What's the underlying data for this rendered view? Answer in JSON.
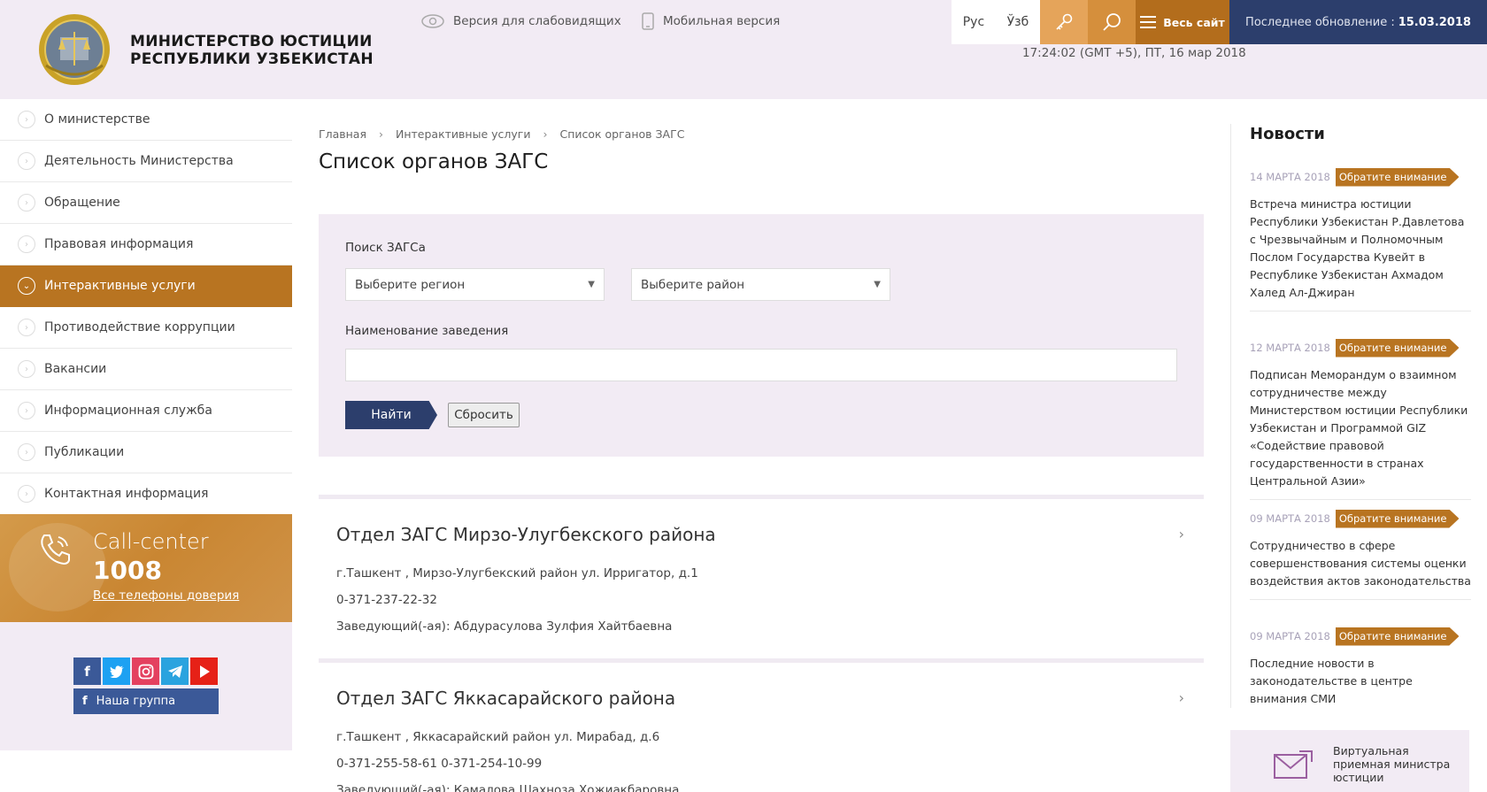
{
  "header": {
    "org_line1": "МИНИСТЕРСТВО ЮСТИЦИИ",
    "org_line2": "РЕСПУБЛИКИ УЗБЕКИСТАН",
    "accessibility_label": "Версия для слабовидящих",
    "mobile_label": "Мобильная версия",
    "lang_ru": "Рус",
    "lang_uz": "Ўзб",
    "menu_label": "Весь сайт",
    "update_label": "Последнее обновление :",
    "update_date": "15.03.2018",
    "datetime": "17:24:02 (GMT +5), ПТ, 16 мар 2018"
  },
  "sidebar": {
    "items": [
      {
        "label": "О министерстве",
        "active": false
      },
      {
        "label": "Деятельность Министерства",
        "active": false
      },
      {
        "label": "Обращение",
        "active": false
      },
      {
        "label": "Правовая информация",
        "active": false
      },
      {
        "label": "Интерактивные услуги",
        "active": true
      },
      {
        "label": "Противодействие коррупции",
        "active": false
      },
      {
        "label": "Вакансии",
        "active": false
      },
      {
        "label": "Информационная служба",
        "active": false
      },
      {
        "label": "Публикации",
        "active": false
      },
      {
        "label": "Контактная информация",
        "active": false
      }
    ],
    "callcenter": {
      "title": "Call-center",
      "number": "1008",
      "link": "Все телефоны доверия"
    },
    "social": {
      "facebook": "f",
      "group_label": "Наша группа"
    }
  },
  "breadcrumb": {
    "home": "Главная",
    "section": "Интерактивные услуги",
    "current": "Список органов ЗАГС"
  },
  "page_title": "Список органов ЗАГС",
  "search": {
    "label": "Поиск ЗАГСа",
    "region_placeholder": "Выберите регион",
    "district_placeholder": "Выберите район",
    "name_label": "Наименование заведения",
    "name_value": "",
    "find_label": "Найти",
    "reset_label": "Сбросить"
  },
  "results": [
    {
      "title": "Отдел ЗАГС Мирзо-Улугбекского района",
      "address": "г.Ташкент , Мирзо-Улугбекский район ул. Ирригатор, д.1",
      "phone": "0-371-237-22-32",
      "head": "Заведующий(-ая): Абдурасулова Зулфия Хайтбаевна"
    },
    {
      "title": "Отдел ЗАГС Яккасарайского района",
      "address": "г.Ташкент , Яккасарайский район ул. Мирабад, д.6",
      "phone": "0-371-255-58-61 0-371-254-10-99",
      "head": "Заведующий(-ая): Камалова Шахноза Хожиакбаровна"
    }
  ],
  "news": {
    "heading": "Новости",
    "items": [
      {
        "date": "14 МАРТА 2018",
        "badge": "Обратите внимание",
        "text": "Встреча министра юстиции Республики Узбекистан Р.Давлетова с Чрезвычайным и Полномочным Послом Государства Кувейт в Республике Узбекистан Ахмадом Халед Ал-Джиран"
      },
      {
        "date": "12 МАРТА 2018",
        "badge": "Обратите внимание",
        "text": "Подписан Меморандум о взаимном сотрудничестве между Министерством юстиции Республики Узбекистан и Программой GIZ «Содействие правовой государственности в странах Центральной Азии»"
      },
      {
        "date": "09 МАРТА 2018",
        "badge": "Обратите внимание",
        "text": "Сотрудничество в сфере совершенствования системы оценки воздействия актов законодательства"
      },
      {
        "date": "09 МАРТА 2018",
        "badge": "Обратите внимание",
        "text": "Последние новости в законодательстве в центре внимания СМИ"
      }
    ],
    "reception": "Виртуальная приемная министра юстиции"
  },
  "colors": {
    "accent_orange": "#b87421",
    "navy": "#2c3e6c",
    "lavender": "#f2ebf4"
  }
}
